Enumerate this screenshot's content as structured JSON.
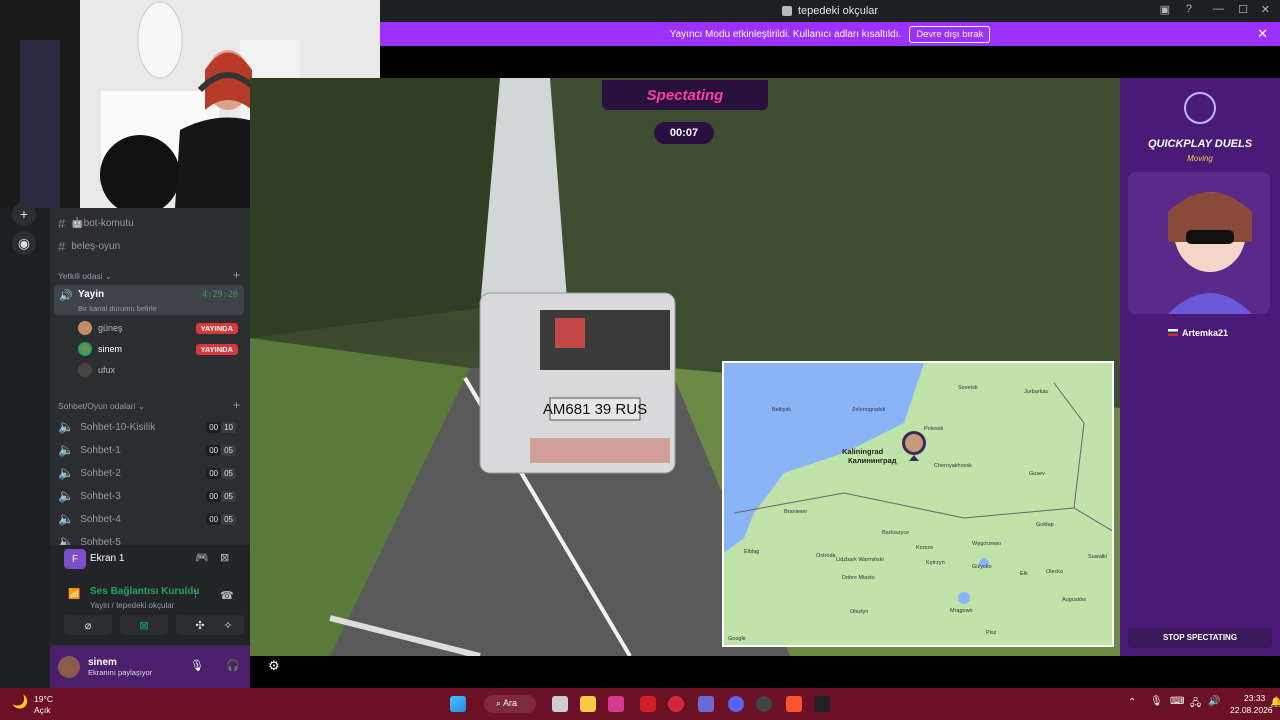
{
  "window": {
    "title": "tepedeki okçular"
  },
  "banner": {
    "text": "Yayıncı Modu etkinleştirildi. Kullanıcı adları kısaltıldı.",
    "button": "Devre dışı bırak"
  },
  "channels": {
    "text": [
      {
        "name": "🤖bot-komutu"
      },
      {
        "name": "beleş-oyun"
      }
    ],
    "category1": "Yetkili odasi",
    "voice_active": {
      "name": "Yayin",
      "time": "4:29:20",
      "status": "Bir kanal durumu belirle"
    },
    "users": [
      {
        "name": "güneş",
        "badge": "YAYINDA"
      },
      {
        "name": "sinem",
        "badge": "YAYINDA"
      },
      {
        "name": "ufux",
        "badge": ""
      }
    ],
    "category2": "Sohbet/Oyun odalari",
    "voice": [
      {
        "name": "Sohbet-10-Kisilik",
        "a": "00",
        "b": "10"
      },
      {
        "name": "Sohbet-1",
        "a": "00",
        "b": "05"
      },
      {
        "name": "Sohbet-2",
        "a": "00",
        "b": "05"
      },
      {
        "name": "Sohbet-3",
        "a": "00",
        "b": "05"
      },
      {
        "name": "Sohbet-4",
        "a": "00",
        "b": "05"
      },
      {
        "name": "Sohbet-5",
        "a": "",
        "b": ""
      }
    ]
  },
  "rtc": {
    "screen_label": "Ekran 1",
    "screen_initial": "F",
    "status": "Ses Bağlantısı Kuruldu",
    "channel": "Yayin / tepedeki okçular"
  },
  "user": {
    "name": "sinem",
    "status": "Ekranını paylaşıyor"
  },
  "game": {
    "spectating": "Spectating",
    "timer": "00:07",
    "mode": "QUICKPLAY DUELS",
    "mode_sub": "Moving",
    "player": "Artemka21",
    "stop": "STOP SPECTATING",
    "bus_plate": "AM681 39 RUS"
  },
  "map": {
    "labels": [
      "Kaliningrad",
      "Калининград",
      "Chernyakhovsk",
      "Gusev",
      "Sovetsk",
      "Jurbarkas",
      "Polessk",
      "Zelenogradsk",
      "Baltiysk",
      "Braniewo",
      "Bartoszyce",
      "Węgorzewo",
      "Gołdap",
      "Elbląg",
      "Ostróda",
      "Dobre Miasto",
      "Olsztyn",
      "Kętrzyn",
      "Giżycko",
      "Ełk",
      "Augustów",
      "Suwałki",
      "Korsze",
      "Lidzbark Warmiński",
      "Mrągowo",
      "Pisz",
      "Olecko",
      "Google"
    ]
  },
  "taskbar": {
    "weather_temp": "19°C",
    "weather_desc": "Açık",
    "search": "Ara",
    "time": "23:33",
    "date": "22.08.2026"
  },
  "colors": {
    "accent": "#9b30ff",
    "live": "#da373c",
    "connected": "#23a55a",
    "taskbar": "#6b1025"
  }
}
